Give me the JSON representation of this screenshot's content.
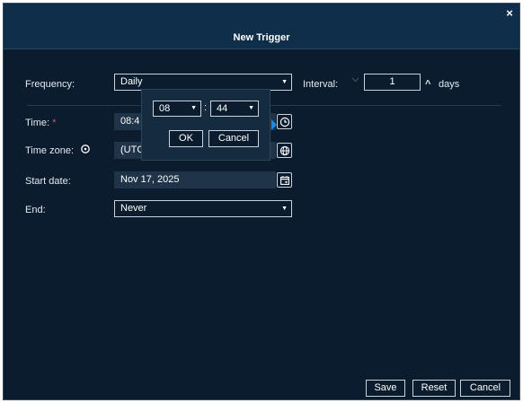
{
  "dialog": {
    "title": "New Trigger",
    "close_glyph": "×"
  },
  "frequency": {
    "label": "Frequency:",
    "value": "Daily",
    "interval_label": "Interval:",
    "interval_value": "1",
    "unit": "days",
    "spinner_glyph": "^"
  },
  "time": {
    "label": "Time:",
    "required_mark": "*",
    "value": "08:4"
  },
  "timezone": {
    "label": "Time zone:",
    "value": "(UTC"
  },
  "start_date": {
    "label": "Start date:",
    "value": "Nov 17, 2025"
  },
  "end": {
    "label": "End:",
    "value": "Never"
  },
  "time_picker": {
    "hour": "08",
    "minute": "44",
    "separator": ":",
    "ok_label": "OK",
    "cancel_label": "Cancel"
  },
  "footer": {
    "save_label": "Save",
    "reset_label": "Reset",
    "cancel_label": "Cancel"
  },
  "caret_glyph": "▼",
  "colors": {
    "background": "#0b1c2e",
    "header": "#0f2e4a",
    "field_fill": "#1f3448",
    "accent_arrow": "#1e88e5",
    "required": "#e8514f"
  }
}
